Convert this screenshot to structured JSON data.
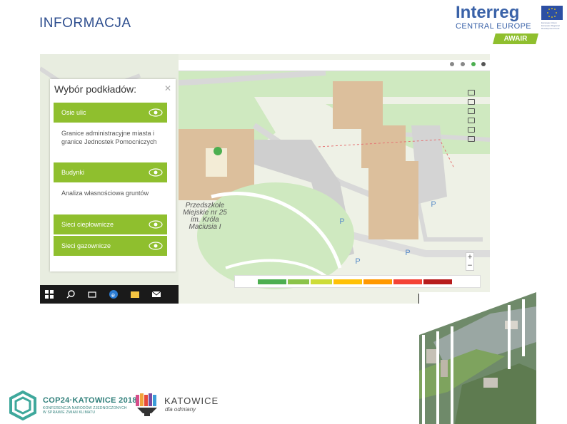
{
  "slide": {
    "title": "INFORMACJA"
  },
  "interreg_logo": {
    "name": "Interreg",
    "region": "CENTRAL EUROPE",
    "project": "AWAIR",
    "eu_text": "European Union European Regional Development Fund",
    "colors": {
      "primary": "#3a62a8",
      "accent": "#8fbf2e"
    }
  },
  "map_app": {
    "panel": {
      "title": "Wybór podkładów:",
      "close_icon": "close-icon",
      "layers": [
        {
          "label": "Osie ulic",
          "active": true
        },
        {
          "label": "Granice administracyjne miasta i granice Jednostek Pomocniczych",
          "active": false
        },
        {
          "label": "Budynki",
          "active": true
        },
        {
          "label": "Analiza własnościowa gruntów",
          "active": false
        },
        {
          "label": "Sieci ciepłownicze",
          "active": true
        },
        {
          "label": "Sieci gazownicze",
          "active": true
        }
      ]
    },
    "map_labels": {
      "school": "Przedszkole Miejskie nr 25 im. Króla Maciusia I",
      "parking": "P"
    },
    "toolbar_icons": [
      "measure-icon",
      "print-icon",
      "bookmark-icon",
      "visibility-icon",
      "share-icon",
      "info-icon"
    ],
    "zoom": {
      "in": "+",
      "out": "−"
    },
    "legend_colors": [
      "#4caf50",
      "#8bc34a",
      "#cddc39",
      "#ffc107",
      "#ff9800",
      "#f44336",
      "#b71c1c"
    ]
  },
  "footer": {
    "cop_title": "COP24·KATOWICE 2018",
    "cop_subtitle": "KONFERENCJA NARODÓW ZJEDNOCZONYCH W SPRAWIE ZMIAN KLIMATU",
    "katowice_title": "KATOWICE",
    "katowice_subtitle": "dla odmiany"
  }
}
